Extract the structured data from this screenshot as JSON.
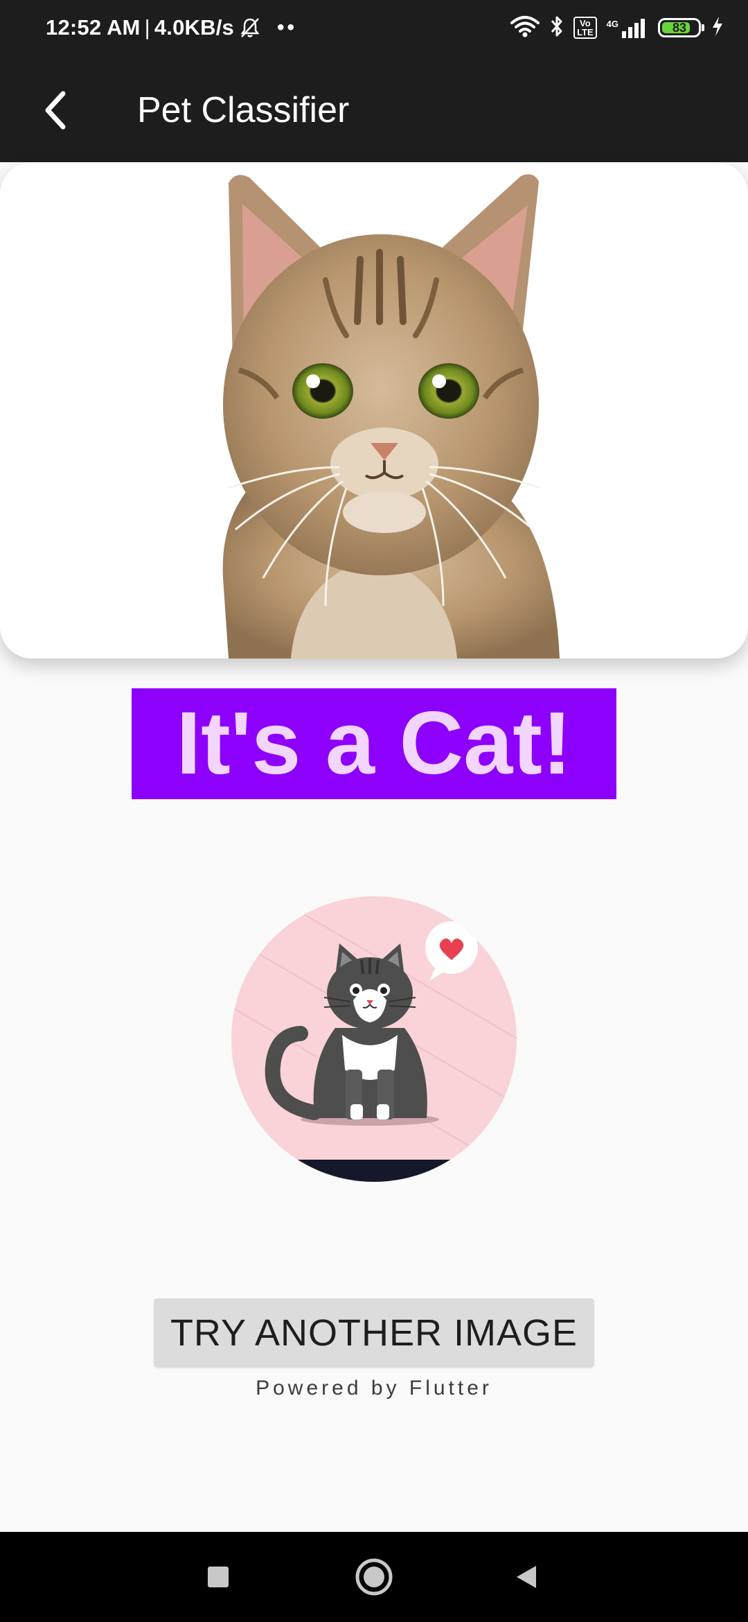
{
  "status_bar": {
    "time": "12:52 AM",
    "separator": "|",
    "speed": "4.0KB/s",
    "dots": "••",
    "volte_line1": "Vo",
    "volte_line2": "LTE",
    "network_type": "4G",
    "battery_level": "83",
    "battery_fraction": 0.83,
    "icons": [
      "mute-bell-icon",
      "wifi-icon",
      "bluetooth-icon",
      "volte-icon",
      "signal-icon",
      "battery-icon",
      "charging-icon"
    ]
  },
  "app_bar": {
    "title": "Pet Classifier",
    "back_icon": "chevron-left-icon"
  },
  "result": {
    "label": "It's a Cat!",
    "banner_color": "#8d00fc",
    "text_color": "#f2d6ff"
  },
  "actions": {
    "try_another_label": "TRY ANOTHER IMAGE"
  },
  "footer": {
    "powered_by": "Powered by Flutter"
  },
  "nav_bar": {
    "icons": [
      "recents-square-icon",
      "home-circle-icon",
      "back-triangle-icon"
    ]
  },
  "colors": {
    "app_bar": "#1d1d1d",
    "background": "#fafafa",
    "button": "#dcdcdc",
    "battery": "#6bd43a",
    "illustration_bg": "#f9d3d7",
    "heart": "#e8404f"
  }
}
